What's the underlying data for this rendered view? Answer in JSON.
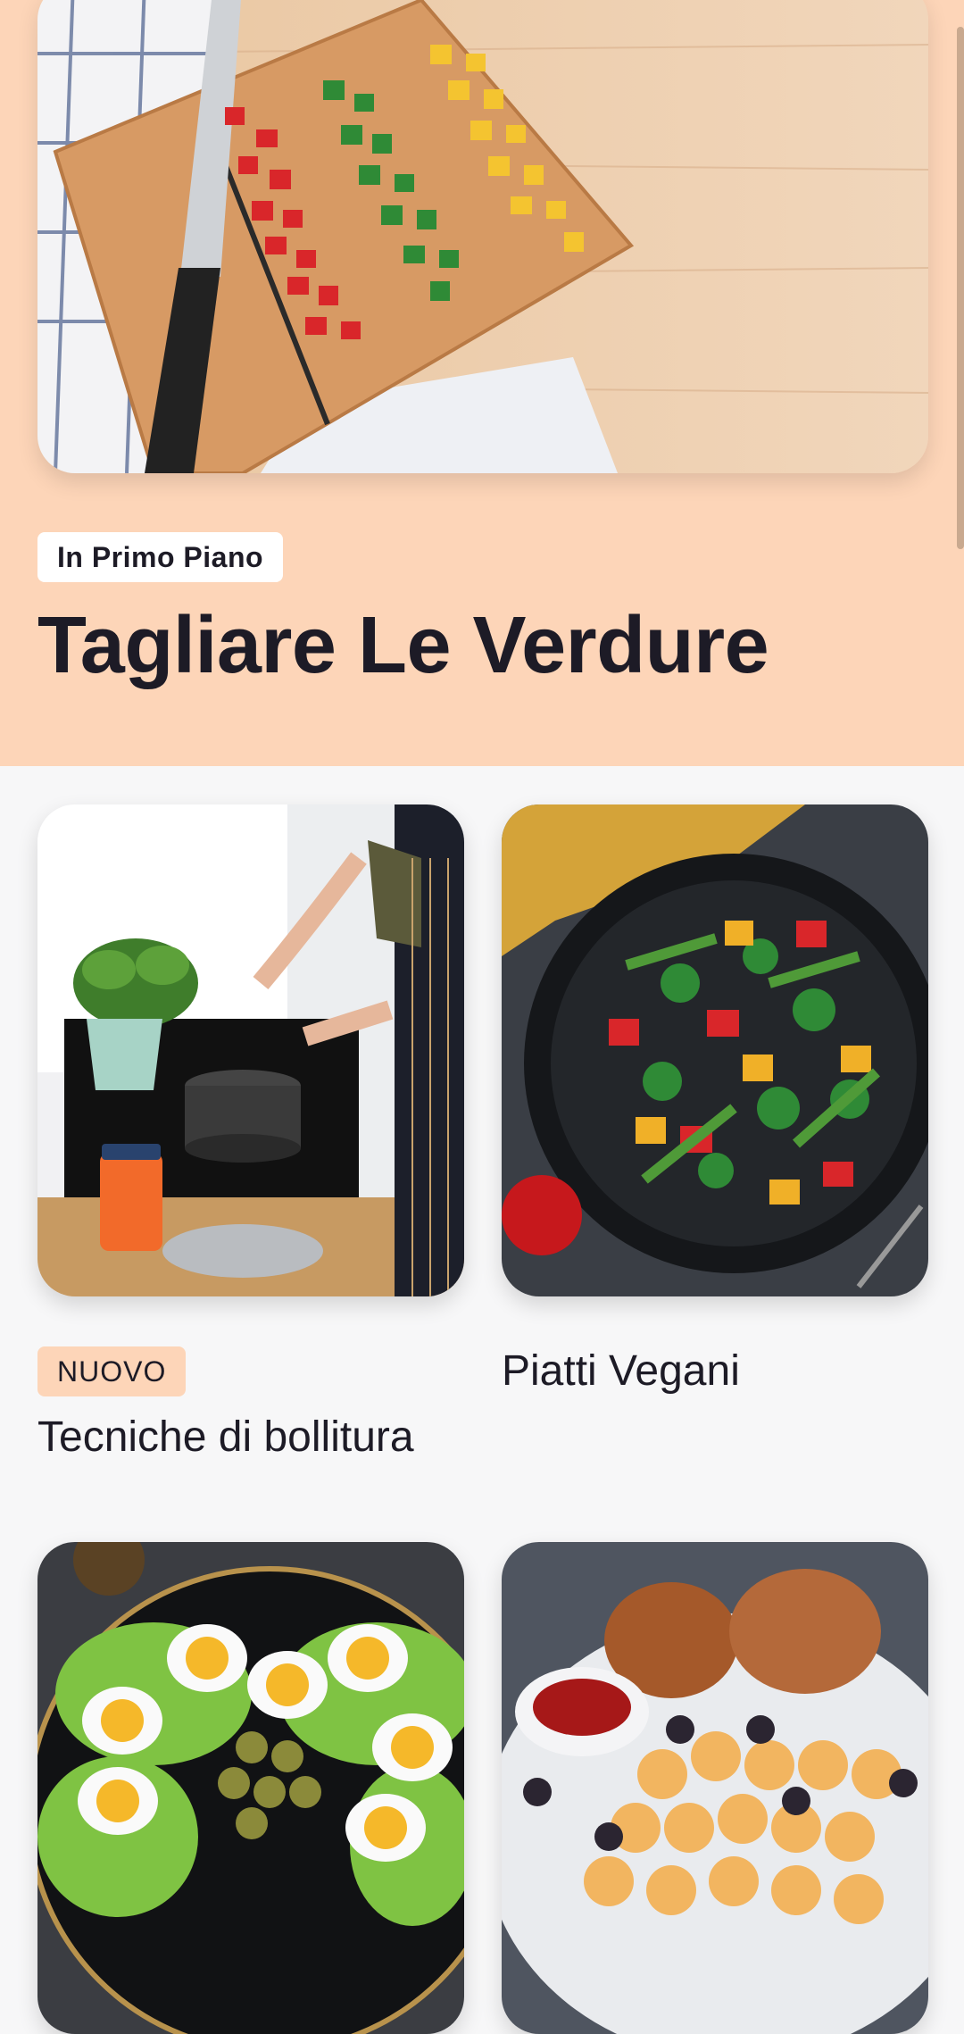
{
  "featured": {
    "badge": "In Primo Piano",
    "title": "Tagliare Le Verdure",
    "image_icon": "cutting-board-vegetables-photo"
  },
  "cards": [
    {
      "badge": "NUOVO",
      "title": "Tecniche di bollitura",
      "image_icon": "boiling-pot-photo"
    },
    {
      "badge": "",
      "title": "Piatti Vegani",
      "image_icon": "vegetable-stir-fry-photo"
    },
    {
      "badge": "",
      "title": "",
      "image_icon": "egg-salad-photo"
    },
    {
      "badge": "",
      "title": "",
      "image_icon": "pasta-chicken-photo"
    }
  ],
  "colors": {
    "hero_bg": "#fdd5b8",
    "page_bg": "#f7f7f8",
    "text": "#1d1b26",
    "badge_new_bg": "#fdd5b8"
  }
}
